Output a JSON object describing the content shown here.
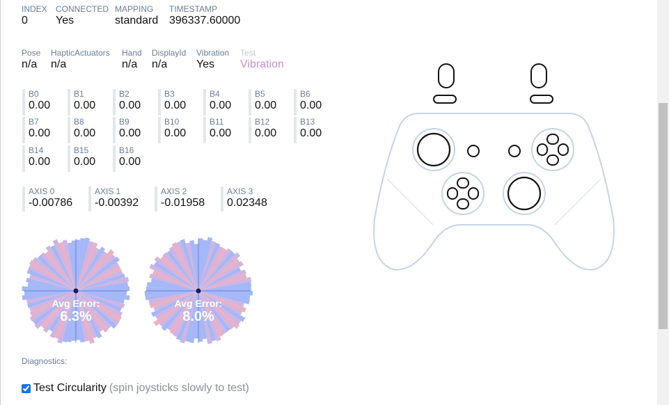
{
  "info_row": [
    {
      "label": "INDEX",
      "value": "0"
    },
    {
      "label": "CONNECTED",
      "value": "Yes"
    },
    {
      "label": "MAPPING",
      "value": "standard"
    },
    {
      "label": "TIMESTAMP",
      "value": "396337.60000"
    }
  ],
  "detail_row": [
    {
      "label": "Pose",
      "value": "n/a"
    },
    {
      "label": "HapticActuators",
      "value": "n/a"
    },
    {
      "label": "Hand",
      "value": "n/a"
    },
    {
      "label": "DisplayId",
      "value": "n/a"
    },
    {
      "label": "Vibration",
      "value": "Yes"
    }
  ],
  "test_vibration": {
    "label": "Test",
    "link": "Vibration"
  },
  "buttons": [
    {
      "label": "B0",
      "value": "0.00"
    },
    {
      "label": "B1",
      "value": "0.00"
    },
    {
      "label": "B2",
      "value": "0.00"
    },
    {
      "label": "B3",
      "value": "0.00"
    },
    {
      "label": "B4",
      "value": "0.00"
    },
    {
      "label": "B5",
      "value": "0.00"
    },
    {
      "label": "B6",
      "value": "0.00"
    },
    {
      "label": "B7",
      "value": "0.00"
    },
    {
      "label": "B8",
      "value": "0.00"
    },
    {
      "label": "B9",
      "value": "0.00"
    },
    {
      "label": "B10",
      "value": "0.00"
    },
    {
      "label": "B11",
      "value": "0.00"
    },
    {
      "label": "B12",
      "value": "0.00"
    },
    {
      "label": "B13",
      "value": "0.00"
    },
    {
      "label": "B14",
      "value": "0.00"
    },
    {
      "label": "B15",
      "value": "0.00"
    },
    {
      "label": "B16",
      "value": "0.00"
    }
  ],
  "axes": [
    {
      "label": "AXIS 0",
      "value": "-0.00786"
    },
    {
      "label": "AXIS 1",
      "value": "-0.00392"
    },
    {
      "label": "AXIS 2",
      "value": "-0.01958"
    },
    {
      "label": "AXIS 3",
      "value": "0.02348"
    }
  ],
  "circularity": [
    {
      "label": "Avg Error:",
      "value": "6.3%"
    },
    {
      "label": "Avg Error:",
      "value": "8.0%"
    }
  ],
  "diagnostics": {
    "title": "Diagnostics:",
    "test_label": "Test Circularity",
    "hint": "(spin joysticks slowly to test)",
    "checked": true
  },
  "colors": {
    "blue": "#5b7cf0",
    "red": "#d86f96",
    "purple": "#a878c9",
    "outline": "#c4d4e4"
  }
}
